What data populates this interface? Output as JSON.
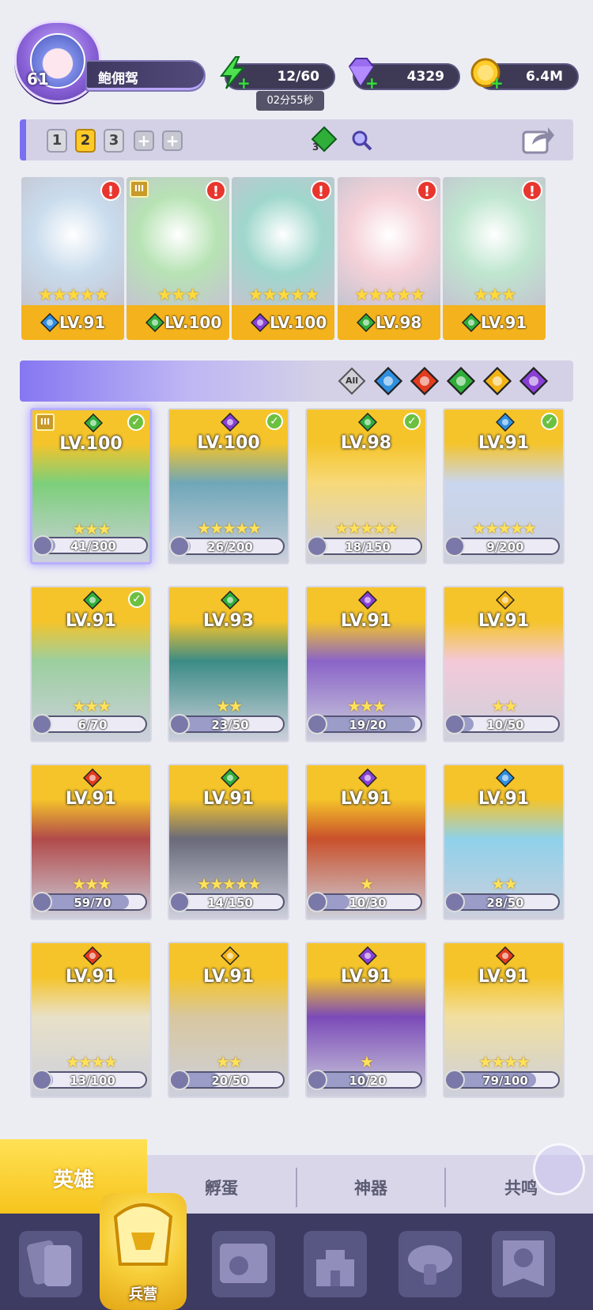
{
  "player": {
    "level": "61",
    "name": "鲍佣驾"
  },
  "resources": {
    "energy": "12/60",
    "energy_timer": "02分55秒",
    "gems": "4329",
    "gold": "6.4M"
  },
  "team_bar": {
    "tabs": [
      "1",
      "2",
      "3"
    ],
    "active_tab": "2",
    "add_labels": [
      "+",
      "+"
    ],
    "gem_count": "3"
  },
  "team": [
    {
      "stars": "★★★★★",
      "level": "LV.91",
      "element": "water",
      "alert": "!"
    },
    {
      "stars": "★★★",
      "level": "LV.100",
      "element": "nature",
      "alert": "!",
      "tier": "III"
    },
    {
      "stars": "★★★★★",
      "level": "LV.100",
      "element": "dark",
      "alert": "!"
    },
    {
      "stars": "★★★★★",
      "level": "LV.98",
      "element": "nature",
      "alert": "!"
    },
    {
      "stars": "★★★",
      "level": "LV.91",
      "element": "nature",
      "alert": "!"
    }
  ],
  "filters": [
    "All",
    "water",
    "fire",
    "nature",
    "light",
    "dark"
  ],
  "filter_all_label": "All",
  "heroes": [
    {
      "level": "LV.100",
      "element": "nature",
      "stars": "★★★",
      "shards": "41/300",
      "progress": 0.14,
      "checked": true,
      "tier": "III",
      "selected": true
    },
    {
      "level": "LV.100",
      "element": "dark",
      "stars": "★★★★★",
      "shards": "26/200",
      "progress": 0.13,
      "checked": true
    },
    {
      "level": "LV.98",
      "element": "nature",
      "stars": "★★★★★",
      "shards": "18/150",
      "progress": 0.12,
      "checked": true
    },
    {
      "level": "LV.91",
      "element": "water",
      "stars": "★★★★★",
      "shards": "9/200",
      "progress": 0.05,
      "checked": true
    },
    {
      "level": "LV.91",
      "element": "nature",
      "stars": "★★★",
      "shards": "6/70",
      "progress": 0.09,
      "checked": true
    },
    {
      "level": "LV.93",
      "element": "nature",
      "stars": "★★",
      "shards": "23/50",
      "progress": 0.46
    },
    {
      "level": "LV.91",
      "element": "dark",
      "stars": "★★★",
      "shards": "19/20",
      "progress": 0.95
    },
    {
      "level": "LV.91",
      "element": "light",
      "stars": "★★",
      "shards": "10/50",
      "progress": 0.2
    },
    {
      "level": "LV.91",
      "element": "fire",
      "stars": "★★★",
      "shards": "59/70",
      "progress": 0.84
    },
    {
      "level": "LV.91",
      "element": "nature",
      "stars": "★★★★★",
      "shards": "14/150",
      "progress": 0.09
    },
    {
      "level": "LV.91",
      "element": "dark",
      "stars": "★",
      "shards": "10/30",
      "progress": 0.33
    },
    {
      "level": "LV.91",
      "element": "water",
      "stars": "★★",
      "shards": "28/50",
      "progress": 0.56
    },
    {
      "level": "LV.91",
      "element": "fire",
      "stars": "★★★★",
      "shards": "13/100",
      "progress": 0.13
    },
    {
      "level": "LV.91",
      "element": "light",
      "stars": "★★",
      "shards": "20/50",
      "progress": 0.4
    },
    {
      "level": "LV.91",
      "element": "dark",
      "stars": "★",
      "shards": "10/20",
      "progress": 0.5
    },
    {
      "level": "LV.91",
      "element": "fire",
      "stars": "★★★★",
      "shards": "79/100",
      "progress": 0.79
    }
  ],
  "tabs": [
    {
      "label": "英雄",
      "active": true
    },
    {
      "label": "孵蛋"
    },
    {
      "label": "神器"
    },
    {
      "label": "共鸣"
    }
  ],
  "bottom_nav": {
    "active_label": "兵营"
  },
  "colors": {
    "accent_gold": "#f5c117",
    "purple": "#7a6ff0",
    "water": "#2f8fe0",
    "fire": "#e23b1e",
    "nature": "#2fae3a",
    "light": "#f2b316",
    "dark": "#8a3fd6"
  }
}
